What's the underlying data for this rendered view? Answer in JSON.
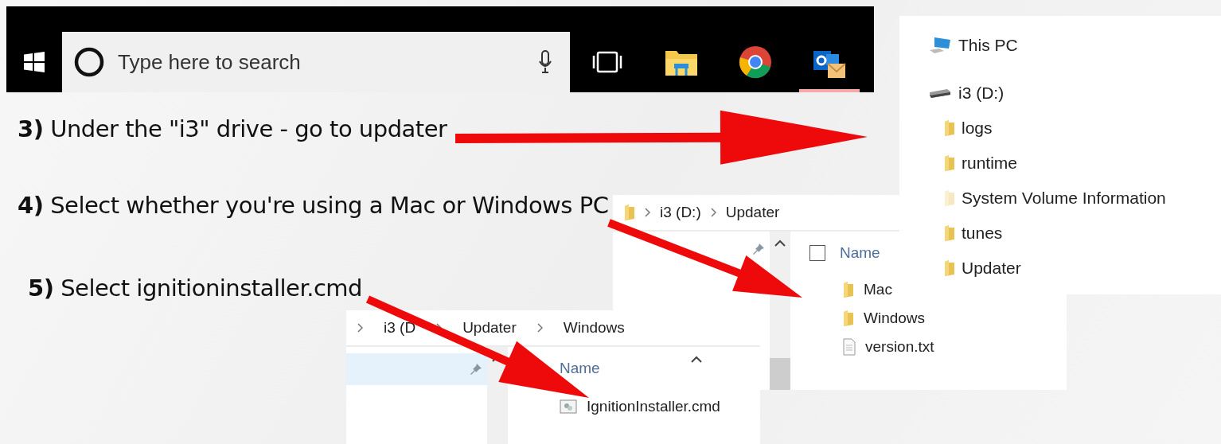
{
  "taskbar": {
    "search": {
      "placeholder": "Type here to search"
    }
  },
  "steps": [
    {
      "text": "**3)** Under the \"i3\" drive - go to updater"
    },
    {
      "text": "**4)** Select whether you're using a Mac or Windows PC"
    },
    {
      "text": "**5)** Select ignitioninstaller.cmd"
    }
  ],
  "navigation_tree": {
    "items": [
      {
        "kind": "pc",
        "label": "This PC"
      },
      {
        "kind": "drive",
        "label": "i3 (D:)",
        "children": [
          {
            "label": "logs",
            "hidden": false
          },
          {
            "label": "runtime",
            "hidden": false
          },
          {
            "label": "System Volume Information",
            "hidden": true
          },
          {
            "label": "tunes",
            "hidden": false
          },
          {
            "label": "Updater",
            "hidden": false
          }
        ]
      }
    ]
  },
  "explorer_updater": {
    "breadcrumb": [
      "i3 (D:)",
      "Updater"
    ],
    "column_header": "Name",
    "checkbox": {
      "checked": false
    },
    "files": [
      {
        "kind": "folder",
        "name": "Mac"
      },
      {
        "kind": "folder",
        "name": "Windows"
      },
      {
        "kind": "text",
        "name": "version.txt"
      }
    ]
  },
  "explorer_windows": {
    "breadcrumb": [
      "i3 (D",
      "Updater",
      "Windows"
    ],
    "column_header": "Name",
    "files": [
      {
        "kind": "script",
        "name": "IgnitionInstaller.cmd"
      }
    ]
  }
}
